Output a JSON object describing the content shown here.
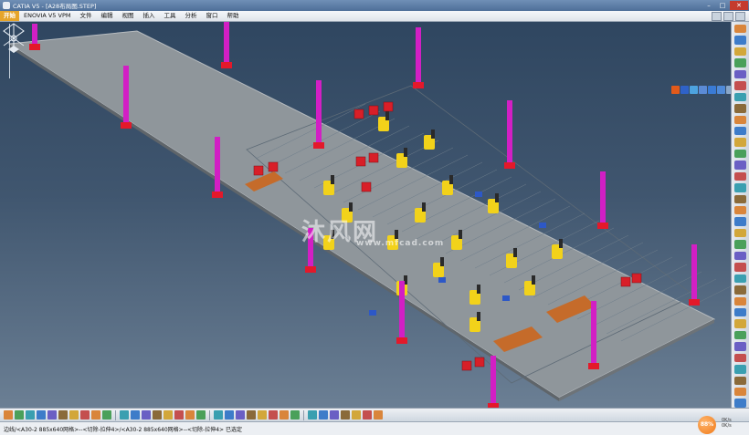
{
  "window": {
    "title": "CATIA V5 - [A28布局图.STEP]",
    "controls": [
      "–",
      "□",
      "✕"
    ]
  },
  "menu": {
    "start": "开始",
    "items": [
      "ENOVIA V5 VPM",
      "文件",
      "编辑",
      "视图",
      "插入",
      "工具",
      "分析",
      "窗口",
      "帮助"
    ]
  },
  "watermark": {
    "main": "沐风网",
    "sub": "www.mfcad.com"
  },
  "statusbar": {
    "message": "边线/<A30-2 885x640网格>--<切除-拉伸4>/<A30-2 885x640网格>--<切除-拉伸4> 已选定"
  },
  "zoom_badge": "88%",
  "speed_info": [
    "0K/s",
    "0K/s"
  ],
  "colors": {
    "floor": "#8f969b",
    "pillar": "#d21fc4",
    "pillar_base": "#e3192a",
    "robot": "#f2d21a",
    "accent": "#f07a1a"
  },
  "icons": {
    "right_toolbar": [
      "select-icon",
      "sketch-icon",
      "part-icon",
      "assembly-icon",
      "constraint-icon",
      "snap-icon",
      "measure-icon",
      "manipulate-icon",
      "explode-icon",
      "clash-icon",
      "section-icon",
      "annotation-icon",
      "catalog-icon",
      "bom-icon",
      "render-icon",
      "simulation-icon",
      "drafting-icon",
      "shape-icon",
      "analysis-icon",
      "fastener-icon",
      "publish-icon",
      "scene-icon",
      "movie-icon",
      "kinematics-icon",
      "tolerance-icon",
      "update-icon",
      "fit-all-icon",
      "zoom-icon",
      "pan-icon",
      "rotate-icon",
      "normal-view-icon",
      "iso-view-icon",
      "hide-show-icon",
      "swap-icon"
    ],
    "bottom_toolbar": [
      "new-icon",
      "open-icon",
      "save-icon",
      "print-icon",
      "cut-icon",
      "copy-icon",
      "paste-icon",
      "undo-icon",
      "redo-icon",
      "help-icon",
      "formula-icon",
      "comment-icon",
      "grid-icon",
      "fit-icon",
      "pan-icon",
      "rotate-icon",
      "zoom-in-icon",
      "zoom-out-icon",
      "normal-icon",
      "view-icon",
      "render-icon",
      "hide-icon",
      "swap-icon",
      "measure-icon",
      "catalog-icon",
      "print-preview-icon",
      "section-icon",
      "analysis-icon",
      "clash-icon",
      "distance-icon",
      "color-icon",
      "material-icon",
      "update-icon"
    ]
  }
}
